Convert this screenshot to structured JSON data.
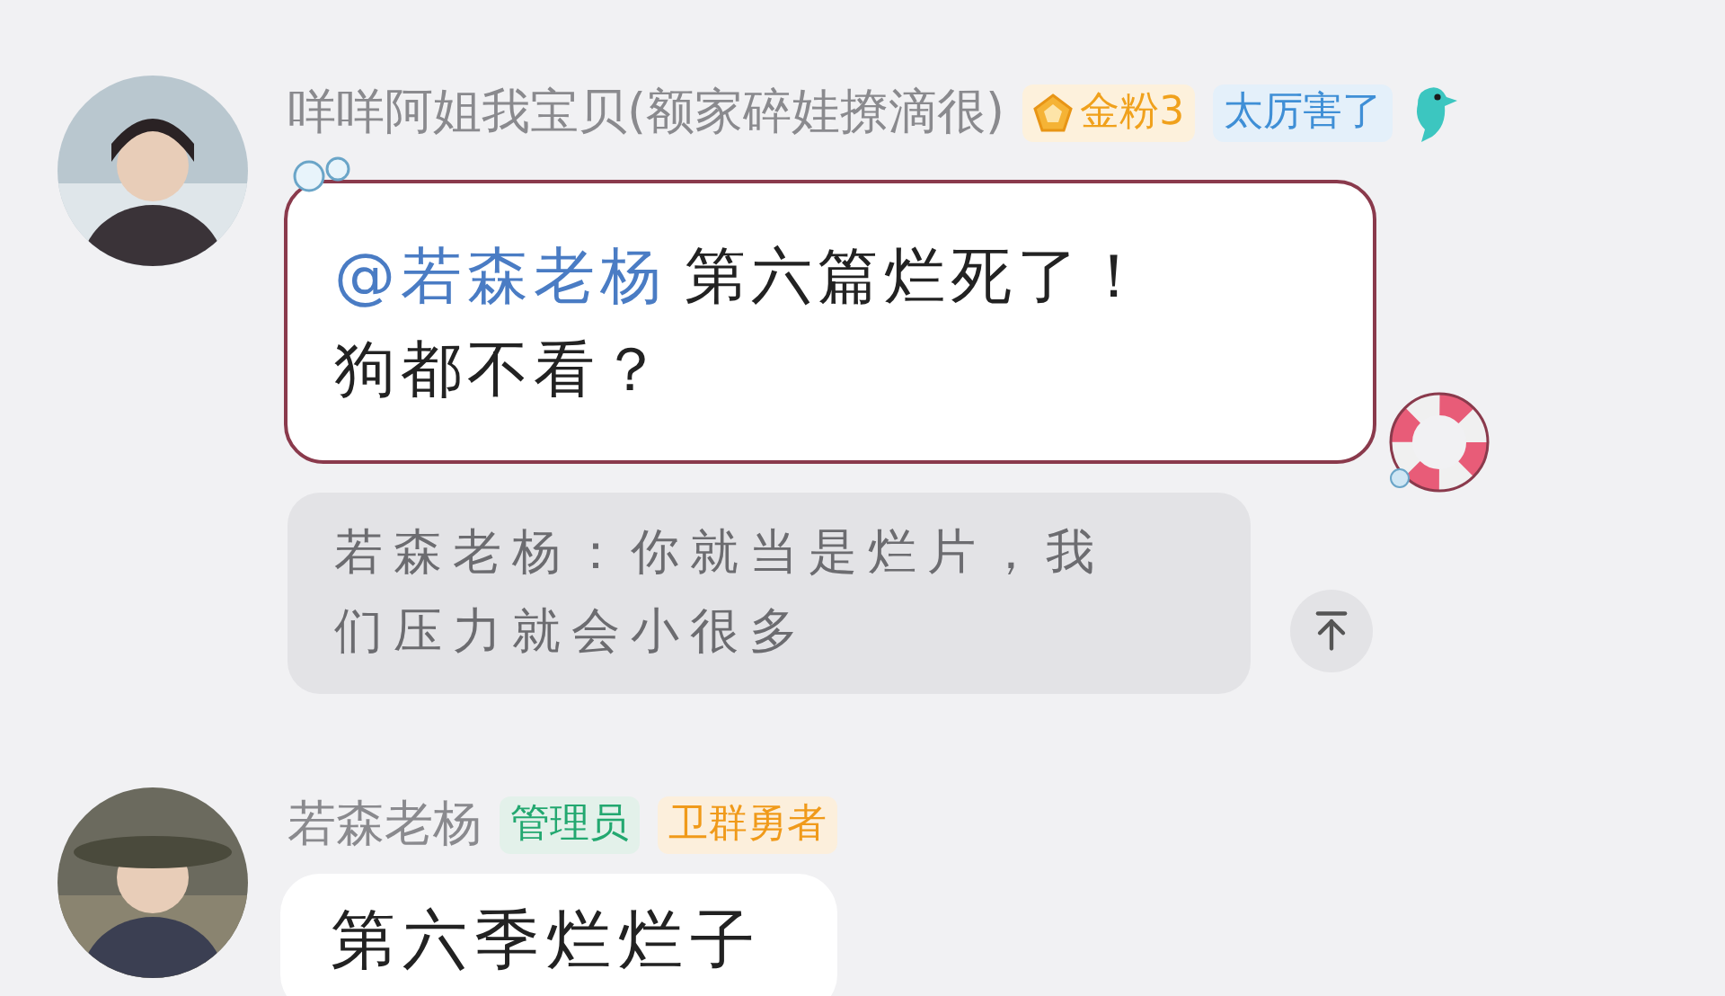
{
  "messages": [
    {
      "kind": "decorated",
      "sender": "咩咩阿姐我宝贝(额家碎娃撩滴很)",
      "badges": [
        {
          "kind": "fan",
          "text": "金粉3"
        },
        {
          "kind": "title",
          "text": "太厉害了"
        }
      ],
      "mention": "@若森老杨",
      "lines": [
        "第六篇烂死了！",
        "狗都不看？"
      ],
      "quote": "若森老杨：你就当是烂片，我们压力就会小很多"
    },
    {
      "kind": "plain",
      "sender": "若森老杨",
      "badges": [
        {
          "kind": "admin",
          "text": "管理员"
        },
        {
          "kind": "honor",
          "text": "卫群勇者"
        }
      ],
      "lines": [
        "第六季烂烂子"
      ]
    }
  ]
}
